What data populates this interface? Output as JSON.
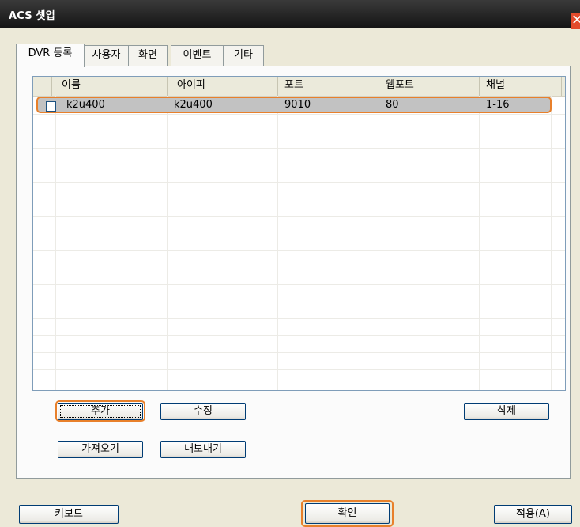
{
  "window": {
    "title": "ACS 셋업"
  },
  "tabs": [
    "DVR 등록",
    "사용자",
    "화면",
    "이벤트",
    "기타"
  ],
  "table": {
    "columns": [
      "이름",
      "아이피",
      "포트",
      "웹포트",
      "채널"
    ],
    "rows": [
      {
        "checked": false,
        "cells": [
          "k2u400",
          "k2u400",
          "9010",
          "80",
          "1-16"
        ]
      }
    ]
  },
  "buttons": {
    "add": "추가",
    "edit": "수정",
    "delete": "삭제",
    "import": "가져오기",
    "export": "내보내기",
    "keyboard": "키보드",
    "ok": "확인",
    "apply": "적용(A)"
  },
  "icons": {
    "close": "close-icon",
    "checkbox": "checkbox"
  },
  "colors": {
    "highlight": "#e8802b",
    "selected_row": "#c2c2c2"
  }
}
